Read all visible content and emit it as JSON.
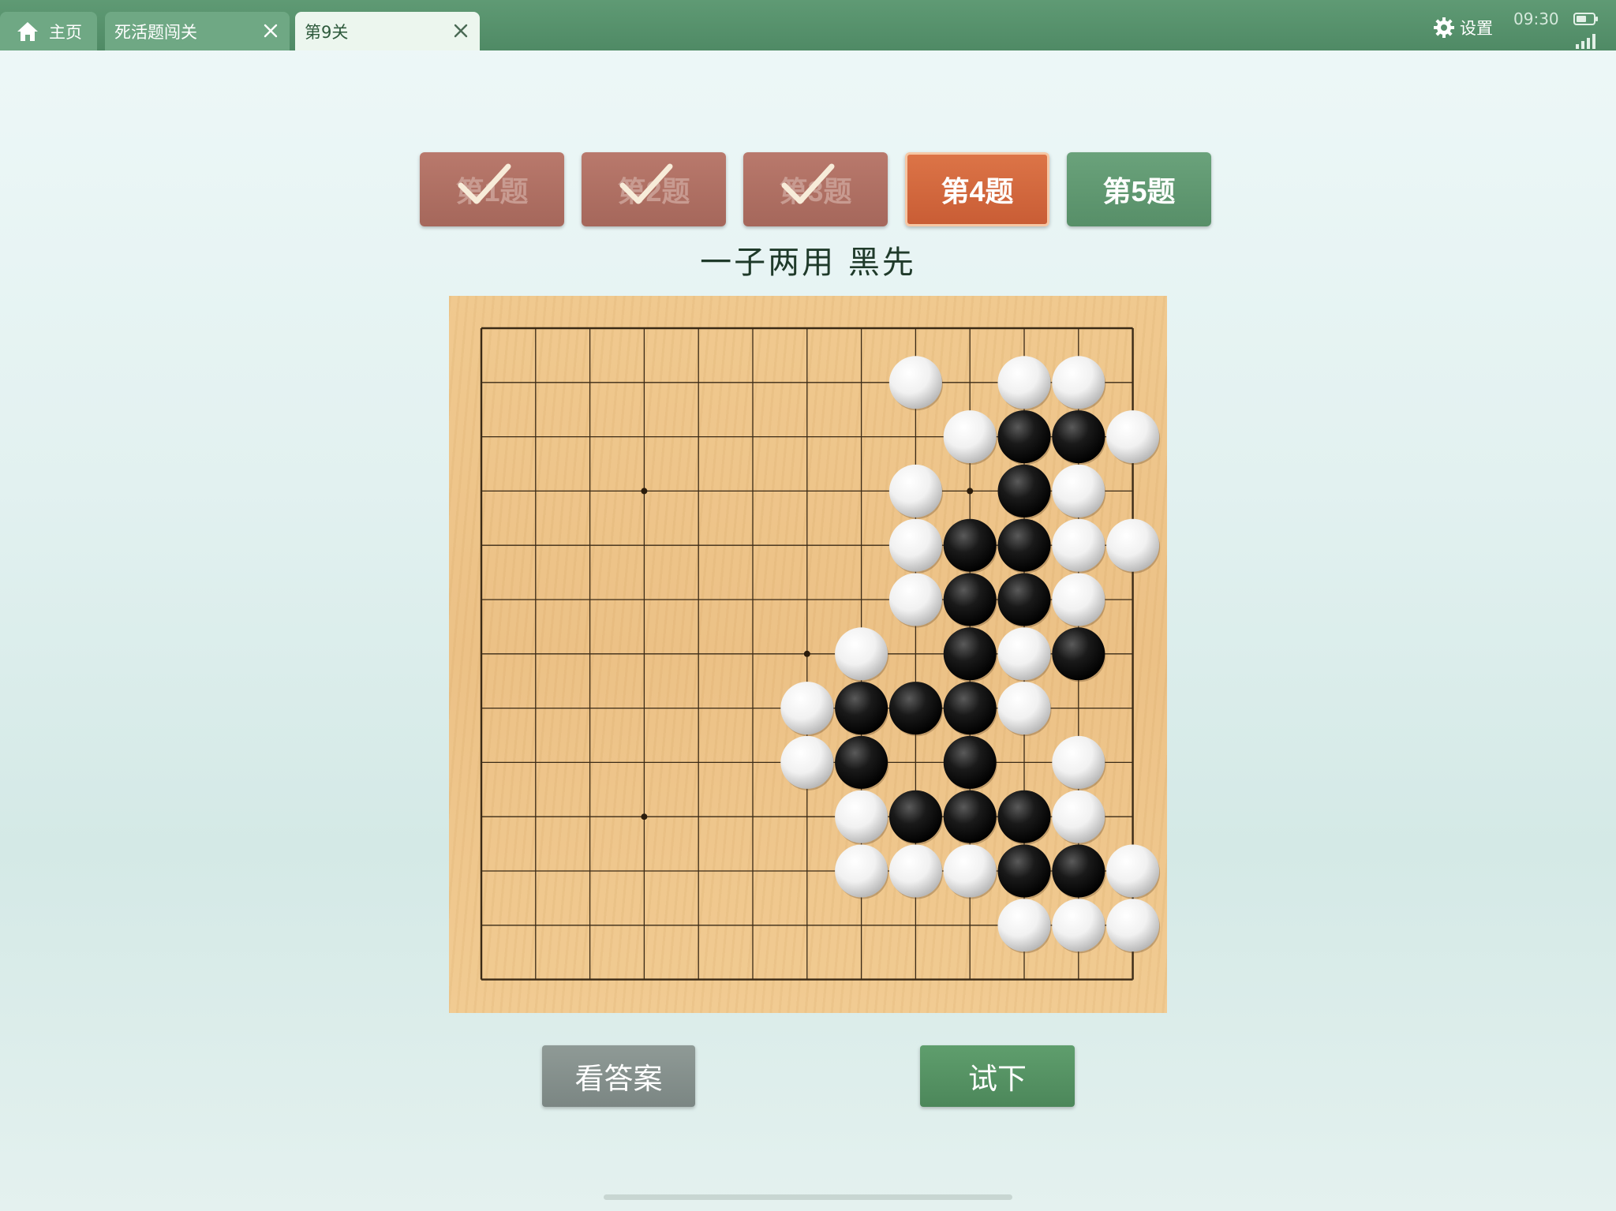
{
  "tabs": [
    {
      "label": "主页",
      "icon": "home-icon",
      "active": false
    },
    {
      "label": "死活题闯关",
      "active": false,
      "closable": true
    },
    {
      "label": "第9关",
      "active": true,
      "closable": true
    }
  ],
  "status": {
    "settings_label": "设置",
    "time": "09:30"
  },
  "questions": [
    {
      "label": "第1题",
      "state": "done"
    },
    {
      "label": "第2题",
      "state": "done"
    },
    {
      "label": "第3题",
      "state": "done"
    },
    {
      "label": "第4题",
      "state": "current"
    },
    {
      "label": "第5题",
      "state": "next"
    }
  ],
  "problem": {
    "title": "一子两用  黑先"
  },
  "board": {
    "size": 13,
    "star_points": [
      [
        3,
        3
      ],
      [
        9,
        3
      ],
      [
        6,
        6
      ],
      [
        3,
        9
      ]
    ],
    "white": [
      [
        8,
        1
      ],
      [
        10,
        1
      ],
      [
        11,
        1
      ],
      [
        9,
        2
      ],
      [
        12,
        2
      ],
      [
        8,
        3
      ],
      [
        11,
        3
      ],
      [
        8,
        4
      ],
      [
        11,
        4
      ],
      [
        12,
        4
      ],
      [
        8,
        5
      ],
      [
        11,
        5
      ],
      [
        7,
        6
      ],
      [
        10,
        6
      ],
      [
        6,
        7
      ],
      [
        10,
        7
      ],
      [
        6,
        8
      ],
      [
        11,
        8
      ],
      [
        7,
        9
      ],
      [
        11,
        9
      ],
      [
        7,
        10
      ],
      [
        8,
        10
      ],
      [
        9,
        10
      ],
      [
        12,
        10
      ],
      [
        10,
        11
      ],
      [
        11,
        11
      ],
      [
        12,
        11
      ]
    ],
    "black": [
      [
        10,
        2
      ],
      [
        11,
        2
      ],
      [
        10,
        3
      ],
      [
        9,
        4
      ],
      [
        10,
        4
      ],
      [
        9,
        5
      ],
      [
        10,
        5
      ],
      [
        9,
        6
      ],
      [
        11,
        6
      ],
      [
        7,
        7
      ],
      [
        8,
        7
      ],
      [
        9,
        7
      ],
      [
        7,
        8
      ],
      [
        9,
        8
      ],
      [
        8,
        9
      ],
      [
        9,
        9
      ],
      [
        10,
        9
      ],
      [
        10,
        10
      ],
      [
        11,
        10
      ]
    ]
  },
  "actions": {
    "answer_label": "看答案",
    "try_label": "试下"
  },
  "colors": {
    "done": "#a96b5f",
    "current": "#d4683e",
    "next": "#5f9971",
    "topbar": "#568f6b"
  }
}
